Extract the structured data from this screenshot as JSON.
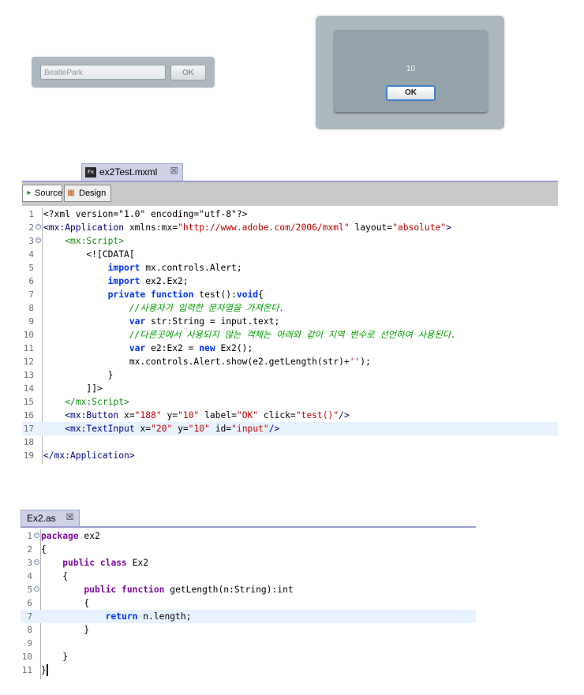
{
  "app_login": {
    "input_value": "BeatlePark",
    "ok_label": "OK"
  },
  "app_alert": {
    "message": "10",
    "ok_label": "OK"
  },
  "editor1": {
    "tab_label": "ex2Test.mxml",
    "file_icon": "Fx",
    "source_label": "Source",
    "design_label": "Design",
    "highlighted_line": 17,
    "lines": [
      {
        "n": "1",
        "fold": false,
        "html": "&lt;?xml version=\"1.0\" encoding=\"utf-8\"?&gt;"
      },
      {
        "n": "2",
        "fold": true,
        "html": "<span class=\"tg\">&lt;mx:Application</span> xmlns:mx=<span class=\"str\">\"http://www.adobe.com/2006/mxml\"</span> layout=<span class=\"str\">\"absolute\"</span><span class=\"tg\">&gt;</span>"
      },
      {
        "n": "3",
        "fold": true,
        "html": "    <span class=\"sc\">&lt;mx:Script&gt;</span>"
      },
      {
        "n": "4",
        "fold": false,
        "html": "        &lt;![CDATA["
      },
      {
        "n": "5",
        "fold": false,
        "html": "            <span class=\"kwb\">import</span> mx.controls.Alert;"
      },
      {
        "n": "6",
        "fold": false,
        "html": "            <span class=\"kwb\">import</span> ex2.Ex2;"
      },
      {
        "n": "7",
        "fold": false,
        "html": "            <span class=\"kwb\">private</span> <span class=\"kwb\">function</span> test():<span class=\"kwb\">void</span>{"
      },
      {
        "n": "8",
        "fold": false,
        "html": "                <span class=\"cm\">//사용자가 입력한 문자열을 가져온다.</span>"
      },
      {
        "n": "9",
        "fold": false,
        "html": "                <span class=\"kwb\">var</span> str:String = input.text;"
      },
      {
        "n": "10",
        "fold": false,
        "html": "                <span class=\"cm\">//다른곳에서 사용되지 않는 객체는 아래와 같이 지역 변수로 선언하여 사용된다.</span>"
      },
      {
        "n": "11",
        "fold": false,
        "html": "                <span class=\"kwb\">var</span> e2:Ex2 = <span class=\"kwb\">new</span> Ex2();"
      },
      {
        "n": "12",
        "fold": false,
        "html": "                mx.controls.Alert.show(e2.getLength(str)+<span class=\"str\">''</span>);"
      },
      {
        "n": "13",
        "fold": false,
        "html": "            }"
      },
      {
        "n": "14",
        "fold": false,
        "html": "        ]]&gt;"
      },
      {
        "n": "15",
        "fold": false,
        "html": "    <span class=\"sc\">&lt;/mx:Script&gt;</span>"
      },
      {
        "n": "16",
        "fold": false,
        "html": "    <span class=\"tg\">&lt;mx:Button</span> x=<span class=\"str\">\"188\"</span> y=<span class=\"str\">\"10\"</span> label=<span class=\"str\">\"OK\"</span> click=<span class=\"str\">\"test()\"</span><span class=\"tg\">/&gt;</span>"
      },
      {
        "n": "17",
        "fold": false,
        "html": "    <span class=\"tg\">&lt;mx:TextInput</span> x=<span class=\"str\">\"20\"</span> y=<span class=\"str\">\"10\"</span> id=<span class=\"str\">\"input\"</span><span class=\"tg\">/&gt;</span>"
      },
      {
        "n": "18",
        "fold": false,
        "html": ""
      },
      {
        "n": "19",
        "fold": false,
        "html": "<span class=\"tg\">&lt;/mx:Application&gt;</span>"
      }
    ]
  },
  "editor2": {
    "tab_label": "Ex2.as",
    "highlighted_line": 7,
    "lines": [
      {
        "n": "1",
        "fold": true,
        "html": "<span class=\"kw\">package</span> ex2"
      },
      {
        "n": "2",
        "fold": false,
        "html": "{"
      },
      {
        "n": "3",
        "fold": true,
        "html": "    <span class=\"kw\">public</span> <span class=\"kw\">class</span> Ex2"
      },
      {
        "n": "4",
        "fold": false,
        "html": "    {"
      },
      {
        "n": "5",
        "fold": true,
        "html": "        <span class=\"kw\">public</span> <span class=\"kw\">function</span> getLength(n:String):int"
      },
      {
        "n": "6",
        "fold": false,
        "html": "        {"
      },
      {
        "n": "7",
        "fold": false,
        "html": "            <span class=\"kwb\">return</span> n.length;"
      },
      {
        "n": "8",
        "fold": false,
        "html": "        }"
      },
      {
        "n": "9",
        "fold": false,
        "html": ""
      },
      {
        "n": "10",
        "fold": false,
        "html": "    }"
      },
      {
        "n": "11",
        "fold": false,
        "html": "}"
      }
    ]
  }
}
